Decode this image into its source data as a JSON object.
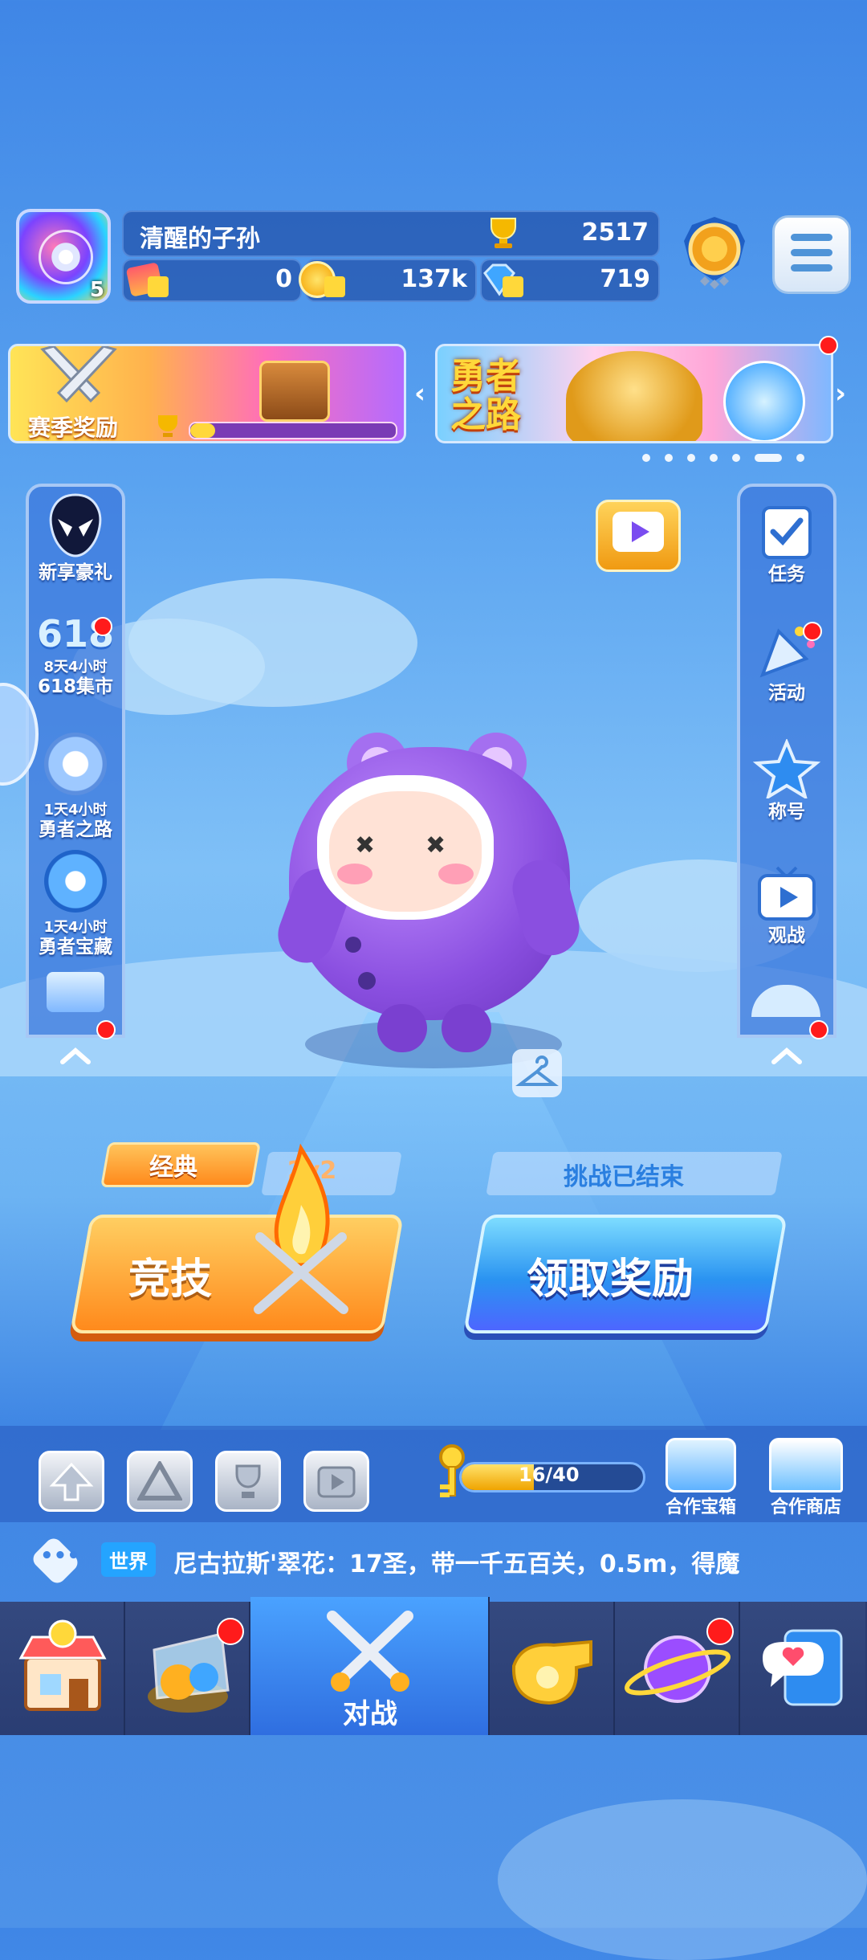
{
  "player": {
    "name": "清醒的子孙",
    "level": "5",
    "trophies": "2517",
    "tickets": "0",
    "coins": "137k",
    "diamonds": "719"
  },
  "banners": {
    "season_reward": "赛季奖励",
    "hero_road": "勇者之路"
  },
  "left_panel": [
    {
      "label": "新享豪礼",
      "timer": ""
    },
    {
      "label": "618集市",
      "timer": "8天4小时",
      "badge_text": "618"
    },
    {
      "label": "勇者之路",
      "timer": "1天4小时"
    },
    {
      "label": "勇者宝藏",
      "timer": "1天4小时"
    }
  ],
  "right_panel": [
    {
      "label": "任务"
    },
    {
      "label": "活动"
    },
    {
      "label": "称号"
    },
    {
      "label": "观战"
    }
  ],
  "modes": {
    "classic_tag": "经典",
    "mode_2v2": "2v2",
    "compete": "竞技",
    "challenge_status": "挑战已结束",
    "claim_reward": "领取奖励"
  },
  "progress": {
    "text": "16/40",
    "value": 0.4
  },
  "shops": {
    "coop_box": "合作宝箱",
    "coop_shop": "合作商店"
  },
  "chat": {
    "channel": "世界",
    "message": "尼古拉斯'翠花：17圣，带一千五百关，0.5m，得魔"
  },
  "nav": {
    "battle": "对战"
  },
  "colors": {
    "accent_orange": "#ff8a1c",
    "accent_blue": "#2a93f1",
    "badge_red": "#ff1b1b"
  }
}
